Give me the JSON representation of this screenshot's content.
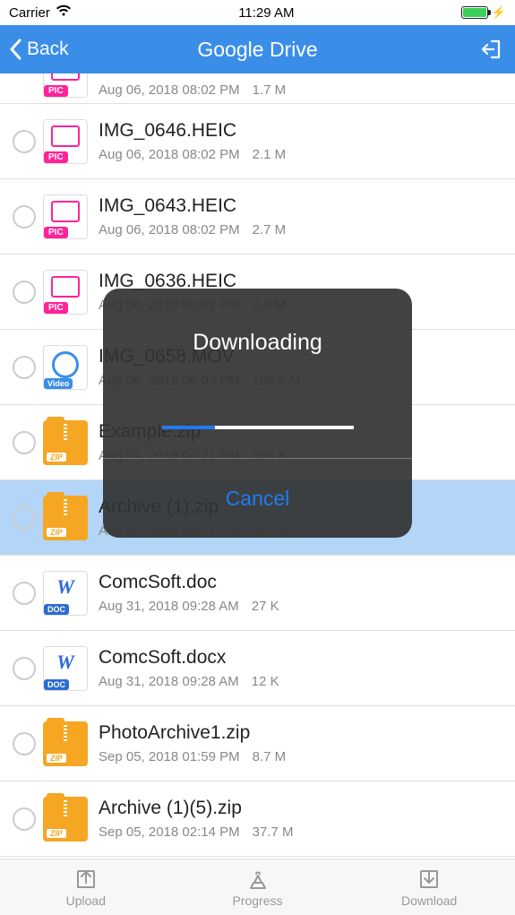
{
  "status": {
    "carrier": "Carrier",
    "time": "11:29 AM"
  },
  "nav": {
    "back": "Back",
    "title": "Google Drive"
  },
  "files": [
    {
      "name": "",
      "date": "Aug 06, 2018 08:02 PM",
      "size": "1.7 M",
      "type": "pic",
      "first": true
    },
    {
      "name": "IMG_0646.HEIC",
      "date": "Aug 06, 2018 08:02 PM",
      "size": "2.1 M",
      "type": "pic"
    },
    {
      "name": "IMG_0643.HEIC",
      "date": "Aug 06, 2018 08:02 PM",
      "size": "2.7 M",
      "type": "pic"
    },
    {
      "name": "IMG_0636.HEIC",
      "date": "Aug 06, 2018 08:02 PM",
      "size": "2.6 M",
      "type": "pic"
    },
    {
      "name": "IMG_0658.MOV",
      "date": "Aug 06, 2018 08:03 PM",
      "size": "185.5 M",
      "type": "video"
    },
    {
      "name": "Example.zip",
      "date": "Aug 24, 2018 04:21 PM",
      "size": "358 K",
      "type": "zip"
    },
    {
      "name": "Archive (1).zip",
      "date": "Aug 24, 2018 04:21 PM",
      "size": "37.7 M",
      "type": "zip",
      "selected": true
    },
    {
      "name": "ComcSoft.doc",
      "date": "Aug 31, 2018 09:28 AM",
      "size": "27 K",
      "type": "doc"
    },
    {
      "name": "ComcSoft.docx",
      "date": "Aug 31, 2018 09:28 AM",
      "size": "12 K",
      "type": "doc"
    },
    {
      "name": "PhotoArchive1.zip",
      "date": "Sep 05, 2018 01:59 PM",
      "size": "8.7 M",
      "type": "zip"
    },
    {
      "name": "Archive (1)(5).zip",
      "date": "Sep 05, 2018 02:14 PM",
      "size": "37.7 M",
      "type": "zip"
    }
  ],
  "icon_labels": {
    "pic": "PIC",
    "video": "Video",
    "zip": "ZIP",
    "doc": "DOC",
    "doc_letter": "W"
  },
  "modal": {
    "title": "Downloading",
    "cancel": "Cancel",
    "progress_pct": 28
  },
  "tabs": {
    "upload": "Upload",
    "progress": "Progress",
    "download": "Download"
  }
}
